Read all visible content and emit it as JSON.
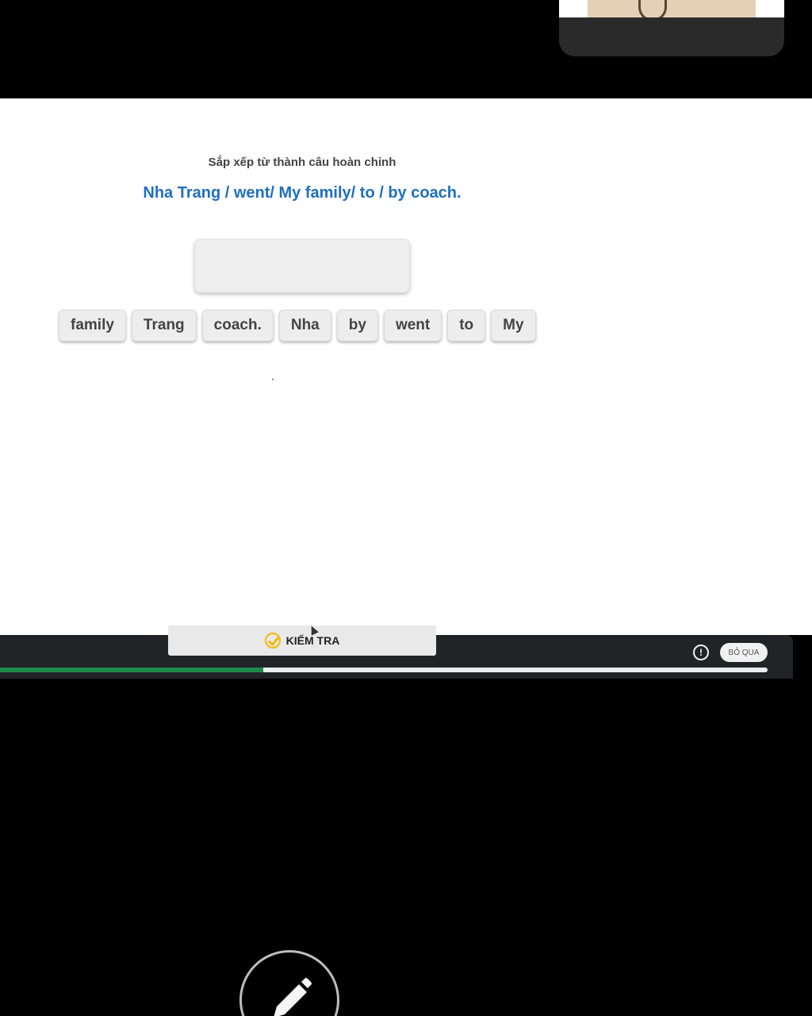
{
  "lesson": {
    "instruction": "Sắp xếp từ thành câu hoàn chỉnh",
    "prompt_sentence": "Nha Trang / went/ My family/ to / by coach.",
    "answer_box_value": "",
    "word_bank": [
      "family",
      "Trang",
      "coach.",
      "Nha",
      "by",
      "went",
      "to",
      "My"
    ]
  },
  "controls": {
    "check_label": "KIỂM TRA",
    "skip_label": "BỎ QUA",
    "info_glyph": "!",
    "progress_fraction": 0.343
  },
  "icons": {
    "check": "check-circle-icon",
    "info": "info-icon",
    "pen": "pen-icon",
    "cursor": "mouse-cursor-icon"
  },
  "colors": {
    "prompt_blue": "#1f6fc0",
    "check_yellow": "#f2b80a",
    "progress_green": "#1c8a4c"
  }
}
